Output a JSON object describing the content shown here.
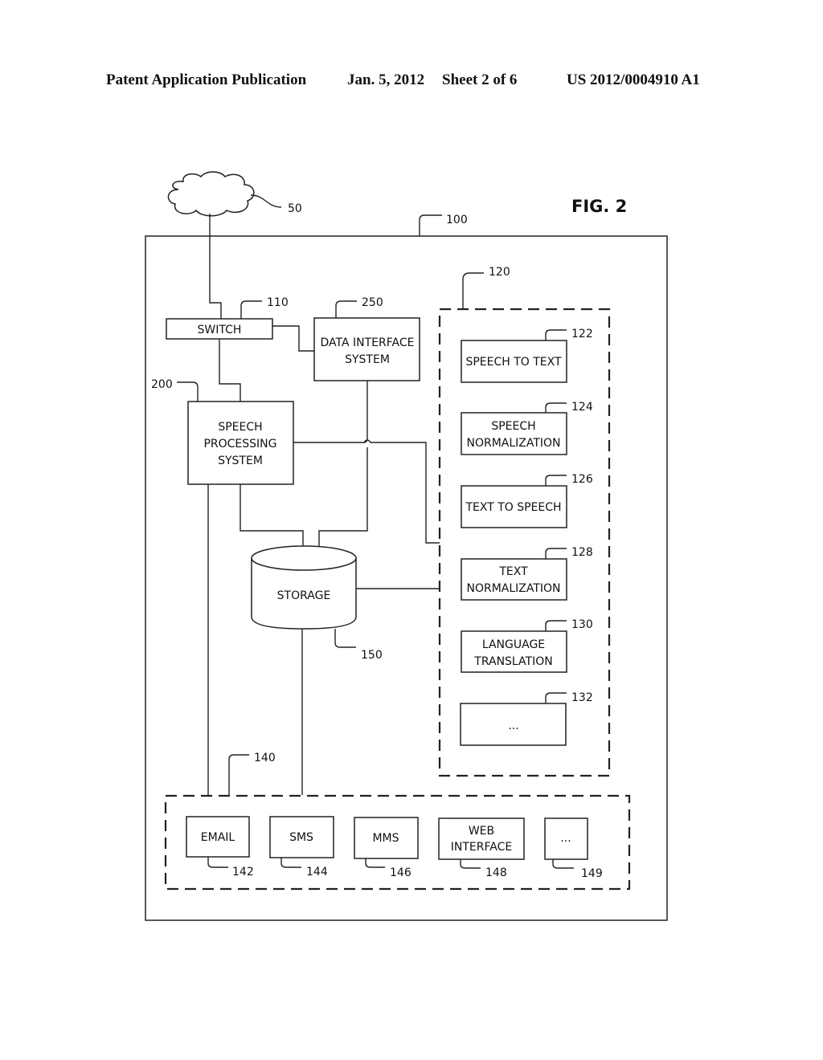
{
  "header": {
    "publication": "Patent Application Publication",
    "date": "Jan. 5, 2012",
    "sheet": "Sheet 2 of 6",
    "number": "US 2012/0004910 A1"
  },
  "figure": {
    "title": "FIG. 2",
    "refs": {
      "network": "50",
      "system": "100",
      "switch": "110",
      "modules_group": "120",
      "speech_to_text": "122",
      "speech_normalization": "124",
      "text_to_speech": "126",
      "text_normalization": "128",
      "language_translation": "130",
      "more_modules": "132",
      "channels_group": "140",
      "email": "142",
      "sms": "144",
      "mms": "146",
      "web_interface": "148",
      "more_channels": "149",
      "storage": "150",
      "speech_processing": "200",
      "data_interface": "250"
    },
    "boxes": {
      "switch": [
        "SWITCH"
      ],
      "data_interface": [
        "DATA INTERFACE",
        "SYSTEM"
      ],
      "speech_processing": [
        "SPEECH",
        "PROCESSING",
        "SYSTEM"
      ],
      "storage": [
        "STORAGE"
      ],
      "speech_to_text": [
        "SPEECH TO TEXT"
      ],
      "speech_normalization": [
        "SPEECH",
        "NORMALIZATION"
      ],
      "text_to_speech": [
        "TEXT TO SPEECH"
      ],
      "text_normalization": [
        "TEXT",
        "NORMALIZATION"
      ],
      "language_translation": [
        "LANGUAGE",
        "TRANSLATION"
      ],
      "more_modules": [
        "..."
      ],
      "email": [
        "EMAIL"
      ],
      "sms": [
        "SMS"
      ],
      "mms": [
        "MMS"
      ],
      "web_interface": [
        "WEB",
        "INTERFACE"
      ],
      "more_channels": [
        "..."
      ]
    }
  }
}
